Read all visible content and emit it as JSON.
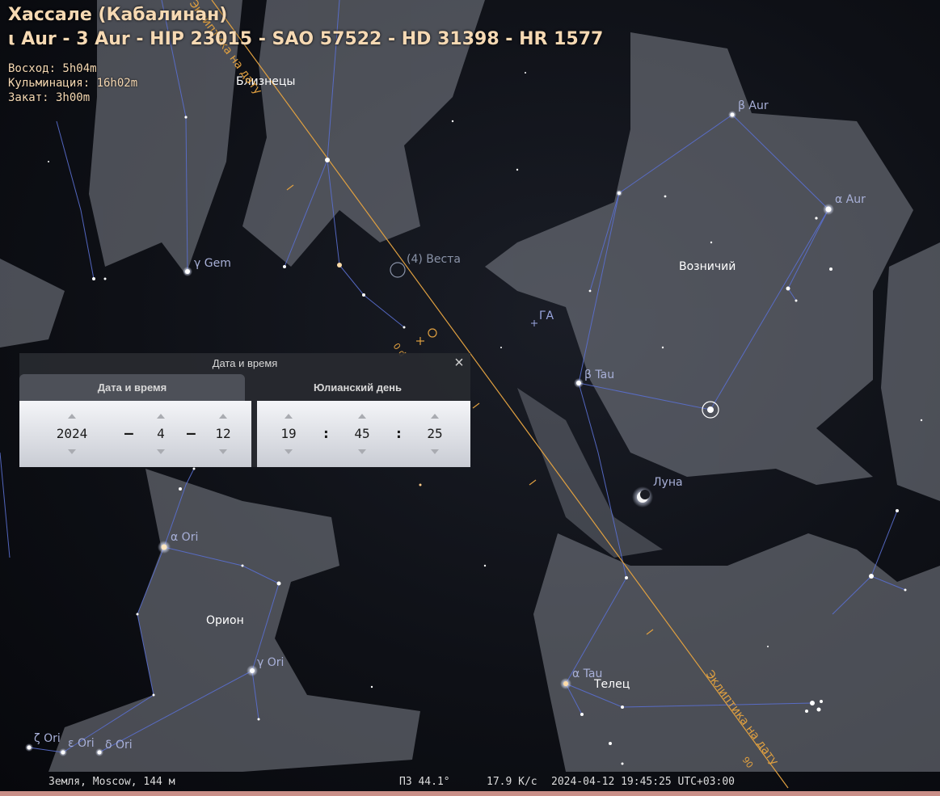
{
  "info": {
    "title": "Хассале (Кабалинан)",
    "designations": "ι Aur - 3 Aur - HIP 23015 - SAO 57522 - HD 31398 - HR 1577",
    "rise": "Восход: 5h04m",
    "transit": "Кульминация: 16h02m",
    "set": "Закат: 3h00m"
  },
  "sky_labels": {
    "gemini": "Близнецы",
    "auriga": "Возничий",
    "orion": "Орион",
    "taurus": "Телец",
    "gamma_gem": "γ Gem",
    "beta_aur": "β Aur",
    "alpha_aur": "α Aur",
    "vesta": "(4) Веста",
    "ga": "ГА",
    "beta_tau": "β Tau",
    "moon": "Луна",
    "alpha_ori": "α Ori",
    "gamma_ori": "γ Ori",
    "alpha_tau": "α Tau",
    "zeta_ori": "ζ Ori",
    "epsilon_ori": "ε Ori",
    "delta_ori": "δ Ori",
    "ecliptic_top": "Эклиптика на дату",
    "ecliptic_bottom": "Эклиптика на дату",
    "ecliptic_mark_top": "0 d",
    "ecliptic_mark_bottom": "90"
  },
  "dialog": {
    "title": "Дата и время",
    "close_icon": "close-icon",
    "tabs": [
      {
        "label": "Дата и время",
        "active": true
      },
      {
        "label": "Юлианский день",
        "active": false
      }
    ],
    "date": {
      "year": "2024",
      "month": "4",
      "day": "12",
      "separator": "–"
    },
    "time": {
      "hour": "19",
      "minute": "45",
      "second": "25",
      "separator": ":"
    }
  },
  "status_bar": {
    "location": "Земля, Moscow, 144 м",
    "fov": "ПЗ 44.1°",
    "fps": "17.9 К/с",
    "datetime": "2024-04-12 19:45:25 UTC+03:00"
  },
  "colors": {
    "info_text": "#f6d9b3",
    "ecliptic": "#e0a040",
    "constellation_lines": "#5a6fd0",
    "art": "#8c8f98"
  }
}
